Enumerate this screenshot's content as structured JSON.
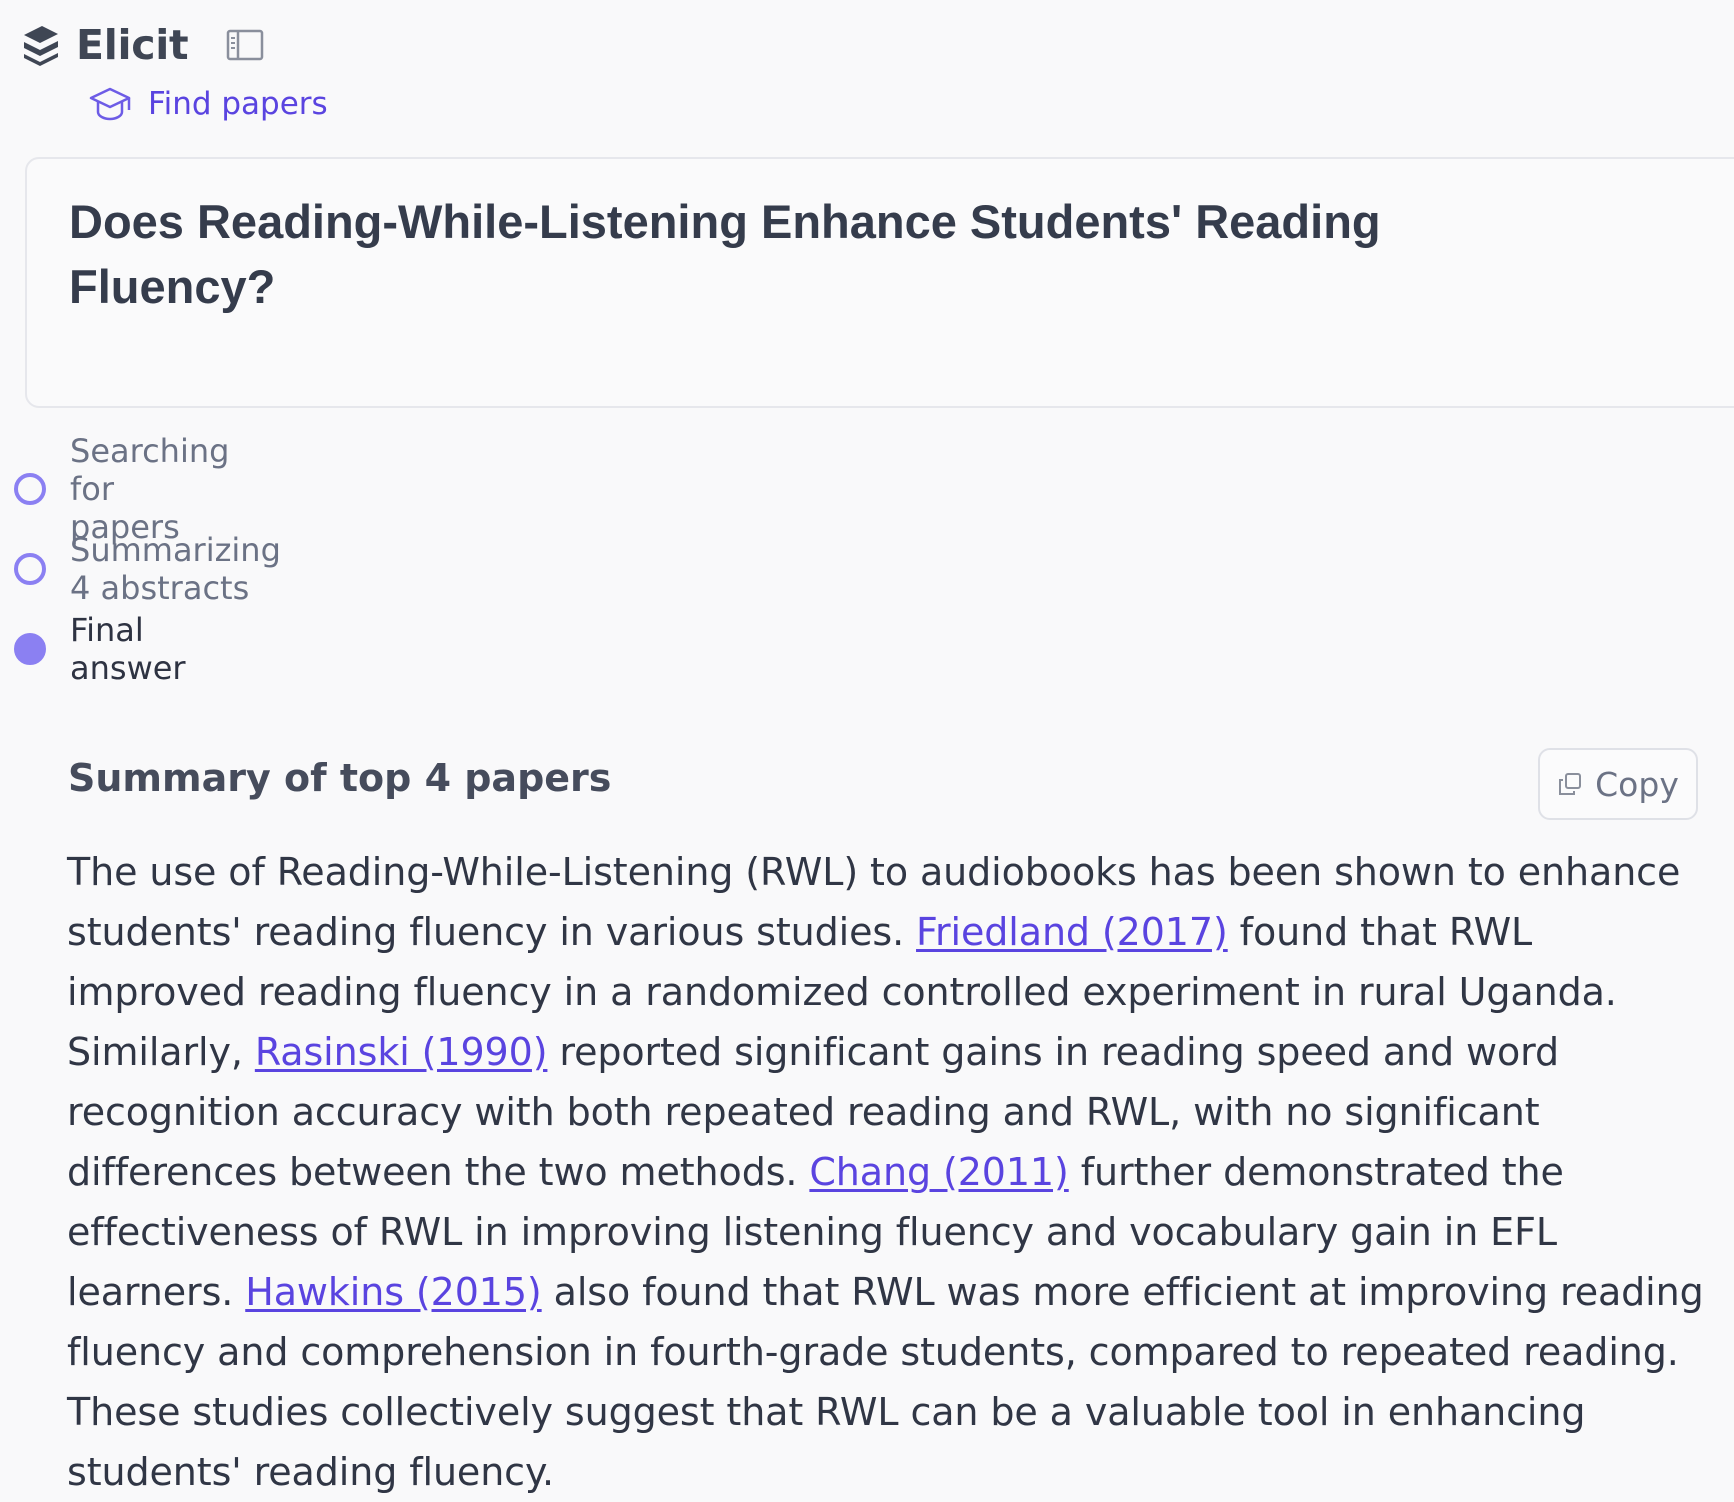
{
  "app": {
    "name": "Elicit",
    "logo_icon": "elicit-logo-icon",
    "sidebar_toggle_icon": "sidebar-toggle-icon"
  },
  "nav": {
    "find_papers": {
      "label": "Find papers",
      "icon": "graduation-cap-icon"
    }
  },
  "question": {
    "title": "Does Reading-While-Listening Enhance Students' Reading Fluency?"
  },
  "steps": [
    {
      "label": "Searching for papers",
      "state": "complete"
    },
    {
      "label": "Summarizing 4 abstracts",
      "state": "complete"
    },
    {
      "label": "Final answer",
      "state": "active"
    }
  ],
  "summary": {
    "heading": "Summary of top 4 papers",
    "copy_label": "Copy",
    "copy_icon": "copy-icon",
    "segments": [
      {
        "text": "The use of Reading-While-Listening (RWL) to audiobooks has been shown to enhance students' reading fluency in various studies. "
      },
      {
        "text": "Friedland (2017)",
        "link": true
      },
      {
        "text": " found that RWL improved reading fluency in a randomized controlled experiment in rural Uganda. Similarly, "
      },
      {
        "text": "Rasinski (1990)",
        "link": true
      },
      {
        "text": " reported significant gains in reading speed and word recognition accuracy with both repeated reading and RWL, with no significant differences between the two methods. "
      },
      {
        "text": "Chang (2011)",
        "link": true
      },
      {
        "text": " further demonstrated the effectiveness of RWL in improving listening fluency and vocabulary gain in EFL learners. "
      },
      {
        "text": "Hawkins (2015)",
        "link": true
      },
      {
        "text": " also found that RWL was more efficient at improving reading fluency and comprehension in fourth-grade students, compared to repeated reading. These studies collectively suggest that RWL can be a valuable tool in enhancing students' reading fluency."
      }
    ]
  },
  "colors": {
    "accent": "#5a44e0",
    "step_dot": "#8b80f2",
    "text": "#303645",
    "muted": "#6b7285",
    "background": "#f9f9fa"
  }
}
